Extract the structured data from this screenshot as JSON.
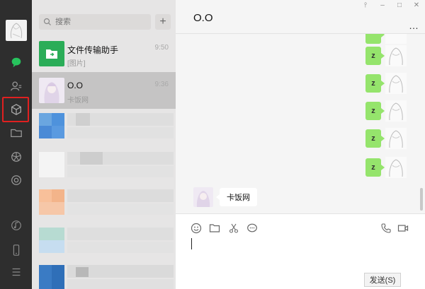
{
  "window": {
    "title": "O.O"
  },
  "search": {
    "placeholder": "搜索"
  },
  "chats": [
    {
      "name": "文件传输助手",
      "preview": "[图片]",
      "time": "9:50",
      "avatar": "folder-icon",
      "color": "#2bad58"
    },
    {
      "name": "O.O",
      "preview": "卡饭网",
      "time": "9:36",
      "active": true
    }
  ],
  "messages": {
    "outgoing_label": "z",
    "incoming_text": "卡饭网"
  },
  "composer": {
    "send_label": "发送(S)"
  },
  "colors": {
    "rail": "#2e2e2e",
    "list": "#e6e5e5",
    "active": "#c5c4c4",
    "bubble_out": "#95e46c",
    "highlight": "#e02020",
    "accent": "#2bad58"
  }
}
